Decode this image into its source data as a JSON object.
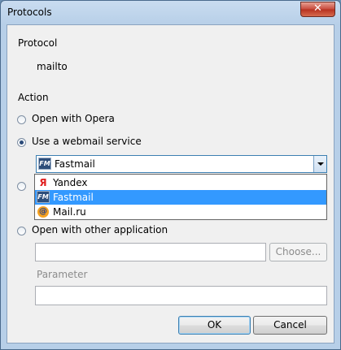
{
  "window": {
    "title": "Protocols",
    "close_symbol": "✕"
  },
  "protocol": {
    "heading": "Protocol",
    "value": "mailto"
  },
  "action": {
    "heading": "Action",
    "options": [
      {
        "label": "Open with Opera",
        "selected": false
      },
      {
        "label": "Use a webmail service",
        "selected": true
      },
      {
        "label": "Open with other application",
        "selected": false
      }
    ]
  },
  "webmail": {
    "selected": "Fastmail",
    "items": [
      {
        "label": "Yandex",
        "icon": "yandex-icon"
      },
      {
        "label": "Fastmail",
        "icon": "fastmail-icon",
        "highlighted": true
      },
      {
        "label": "Mail.ru",
        "icon": "mailru-icon"
      }
    ],
    "icon_glyphs": {
      "yandex": "Я",
      "fastmail": "FM",
      "mailru": "@"
    }
  },
  "application": {
    "path_value": "",
    "choose_label": "Choose...",
    "parameter_label": "Parameter",
    "parameter_value": ""
  },
  "buttons": {
    "ok": "OK",
    "cancel": "Cancel"
  },
  "colors": {
    "selection": "#3399ff",
    "accent_border": "#3c7fb1"
  }
}
